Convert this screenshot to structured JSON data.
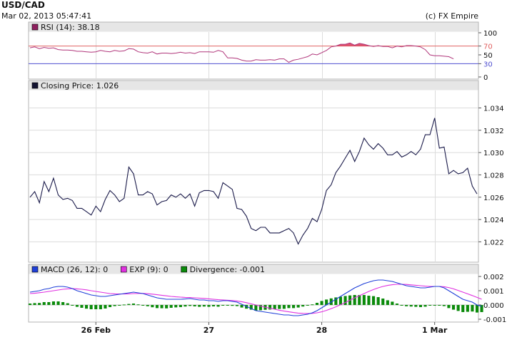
{
  "header": {
    "symbol": "USD/CAD",
    "timestamp": "Mar 02, 2013 05:47:41",
    "copyright": "(c) FX Empire"
  },
  "colors": {
    "panel_bg": "#ffffff",
    "panel_border": "#b4b4b4",
    "label_bar": "#e6e6e6",
    "grid": "#dcdcdc",
    "rsi_line": "#b0357a",
    "rsi_upper": "#e06060",
    "rsi_lower": "#5050d0",
    "price_line": "#1a1a4a",
    "macd_line": "#1f3fd8",
    "exp_line": "#e030e0",
    "divergence_bar": "#0a8a0a"
  },
  "x_axis": {
    "ticks": [
      {
        "label": "26 Feb",
        "i": 14
      },
      {
        "label": "27",
        "i": 38
      },
      {
        "label": "28",
        "i": 62
      },
      {
        "label": "1 Mar",
        "i": 86
      }
    ]
  },
  "chart_data": [
    {
      "type": "line",
      "name": "rsi",
      "label": "RSI (14): 38.18",
      "legend_color": "#8e1f5e",
      "ylim": [
        0,
        100
      ],
      "yticks": [
        "100",
        "70",
        "50",
        "30",
        "0"
      ],
      "ytick_values": [
        100,
        70,
        50,
        30,
        0
      ],
      "levels": [
        70,
        30
      ],
      "values": [
        66,
        68,
        64,
        67,
        65,
        66,
        62,
        61,
        61,
        60,
        58,
        58,
        57,
        56,
        57,
        60,
        58,
        57,
        60,
        58,
        59,
        64,
        63,
        57,
        55,
        54,
        57,
        52,
        54,
        54,
        53,
        54,
        56,
        54,
        55,
        53,
        57,
        57,
        57,
        56,
        60,
        57,
        43,
        43,
        42,
        38,
        36,
        36,
        39,
        38,
        38,
        39,
        38,
        41,
        41,
        33,
        38,
        40,
        43,
        46,
        52,
        50,
        55,
        60,
        68,
        70,
        74,
        74,
        77,
        72,
        76,
        74,
        71,
        69,
        71,
        69,
        69,
        66,
        70,
        68,
        71,
        71,
        70,
        68,
        62,
        50,
        48,
        48,
        47,
        46,
        41
      ]
    },
    {
      "type": "line",
      "name": "price",
      "label": "Closing Price: 1.026",
      "legend_color": "#141432",
      "ylim": [
        1.0203,
        1.0355
      ],
      "yticks": [
        "1.034",
        "1.032",
        "1.030",
        "1.028",
        "1.026",
        "1.024",
        "1.022"
      ],
      "ytick_values": [
        1.034,
        1.032,
        1.03,
        1.028,
        1.026,
        1.024,
        1.022
      ],
      "values": [
        1.026,
        1.0265,
        1.0255,
        1.0274,
        1.0265,
        1.0277,
        1.0262,
        1.0258,
        1.0259,
        1.0257,
        1.025,
        1.025,
        1.0247,
        1.0244,
        1.0252,
        1.0247,
        1.0258,
        1.0266,
        1.0262,
        1.0256,
        1.0259,
        1.0287,
        1.0281,
        1.0262,
        1.0262,
        1.0265,
        1.0263,
        1.0253,
        1.0256,
        1.0257,
        1.0262,
        1.026,
        1.0263,
        1.0259,
        1.0263,
        1.0252,
        1.0264,
        1.0266,
        1.0266,
        1.0265,
        1.0259,
        1.0273,
        1.027,
        1.0267,
        1.025,
        1.0249,
        1.0243,
        1.0232,
        1.023,
        1.0233,
        1.0233,
        1.0228,
        1.0228,
        1.0228,
        1.023,
        1.0232,
        1.0228,
        1.0218,
        1.0226,
        1.0232,
        1.0241,
        1.0238,
        1.0249,
        1.0266,
        1.0271,
        1.0282,
        1.0288,
        1.0295,
        1.0302,
        1.0292,
        1.0301,
        1.0313,
        1.0307,
        1.0303,
        1.0308,
        1.0304,
        1.0298,
        1.0298,
        1.0301,
        1.0296,
        1.0298,
        1.0301,
        1.0298,
        1.0303,
        1.0316,
        1.0316,
        1.0331,
        1.0304,
        1.0305,
        1.0281,
        1.0284,
        1.0281,
        1.0282,
        1.0286,
        1.027,
        1.0263
      ]
    },
    {
      "type": "line",
      "name": "macd",
      "label": "MACD (26, 12): 0",
      "ylim": [
        -0.0011,
        0.0021
      ],
      "yticks": [
        "0.002",
        "0.001",
        "0.000",
        "-0.001"
      ],
      "ytick_values": [
        0.002,
        0.001,
        0.0,
        -0.001
      ],
      "series": [
        {
          "name": "MACD (26, 12): 0",
          "legend_color": "#1f3fd8",
          "color": "#1f3fd8",
          "values": [
            0.0009,
            0.00095,
            0.001,
            0.0011,
            0.00115,
            0.00125,
            0.0013,
            0.0013,
            0.00125,
            0.00115,
            0.001,
            0.0009,
            0.0008,
            0.0007,
            0.00065,
            0.0006,
            0.0006,
            0.00065,
            0.0007,
            0.00075,
            0.0008,
            0.00085,
            0.0009,
            0.00085,
            0.0008,
            0.0007,
            0.0006,
            0.0005,
            0.00045,
            0.0004,
            0.0004,
            0.0004,
            0.0004,
            0.00042,
            0.00045,
            0.0004,
            0.00035,
            0.00035,
            0.0003,
            0.0003,
            0.00025,
            0.0003,
            0.0003,
            0.00025,
            0.0002,
            5e-05,
            -0.0001,
            -0.00025,
            -0.0004,
            -0.00045,
            -0.0005,
            -0.00055,
            -0.0006,
            -0.00065,
            -0.0007,
            -0.0007,
            -0.00075,
            -0.00075,
            -0.0007,
            -0.00065,
            -0.00055,
            -0.0004,
            -0.0002,
            0.0,
            0.0002,
            0.0004,
            0.0006,
            0.0008,
            0.001,
            0.0012,
            0.00135,
            0.0015,
            0.0016,
            0.0017,
            0.00175,
            0.00175,
            0.0017,
            0.00165,
            0.00155,
            0.00145,
            0.00135,
            0.0013,
            0.00125,
            0.0012,
            0.0012,
            0.00125,
            0.0013,
            0.0013,
            0.0012,
            0.001,
            0.0008,
            0.0006,
            0.0004,
            0.0003,
            0.0002,
            0.0,
            -0.0001
          ]
        },
        {
          "name": "EXP (9): 0",
          "legend_color": "#e030e0",
          "color": "#e030e0",
          "values": [
            0.0008,
            0.00082,
            0.00086,
            0.0009,
            0.00095,
            0.001,
            0.00105,
            0.0011,
            0.00113,
            0.00115,
            0.00113,
            0.0011,
            0.00106,
            0.001,
            0.00095,
            0.0009,
            0.00085,
            0.0008,
            0.00078,
            0.00077,
            0.00077,
            0.00078,
            0.0008,
            0.00081,
            0.00081,
            0.00079,
            0.00076,
            0.00072,
            0.00068,
            0.00064,
            0.0006,
            0.00057,
            0.00055,
            0.00053,
            0.00052,
            0.0005,
            0.00048,
            0.00046,
            0.00043,
            0.0004,
            0.00037,
            0.00035,
            0.00033,
            0.00031,
            0.00028,
            0.00023,
            0.00016,
            8e-05,
            0.0,
            -8e-05,
            -0.00016,
            -0.00023,
            -0.0003,
            -0.00037,
            -0.00043,
            -0.00048,
            -0.00053,
            -0.00057,
            -0.00059,
            -0.0006,
            -0.00059,
            -0.00055,
            -0.00048,
            -0.00038,
            -0.00026,
            -0.00013,
            2e-05,
            0.00017,
            0.00033,
            0.0005,
            0.00065,
            0.0008,
            0.00095,
            0.00108,
            0.0012,
            0.0013,
            0.00137,
            0.00142,
            0.00145,
            0.00145,
            0.00144,
            0.00141,
            0.00138,
            0.00135,
            0.00132,
            0.0013,
            0.0013,
            0.0013,
            0.00128,
            0.00122,
            0.00113,
            0.00102,
            0.0009,
            0.00078,
            0.00066,
            0.00053,
            0.0004
          ]
        },
        {
          "name": "Divergence: -0.001",
          "legend_color": "#0a8a0a",
          "color": "#0a8a0a",
          "kind": "bar",
          "values": [
            0.0001,
            0.00013,
            0.00014,
            0.0002,
            0.0002,
            0.00025,
            0.00025,
            0.0002,
            0.00012,
            0.0,
            -0.00013,
            -0.0002,
            -0.00026,
            -0.0003,
            -0.0003,
            -0.0003,
            -0.00025,
            -0.00015,
            -8e-05,
            -2e-05,
            3e-05,
            7e-05,
            0.0001,
            4e-05,
            -1e-05,
            -9e-05,
            -0.00016,
            -0.00022,
            -0.00023,
            -0.00024,
            -0.0002,
            -0.00017,
            -0.00015,
            -0.00011,
            -7e-05,
            -0.0001,
            -0.00013,
            -0.00011,
            -0.00013,
            -0.0001,
            -0.00012,
            -5e-05,
            -3e-05,
            -6e-05,
            -8e-05,
            -0.00018,
            -0.00026,
            -0.00033,
            -0.0004,
            -0.00037,
            -0.00034,
            -0.00032,
            -0.0003,
            -0.00028,
            -0.00027,
            -0.00022,
            -0.00022,
            -0.00018,
            -0.00011,
            -5e-05,
            4e-05,
            0.00015,
            0.00028,
            0.00038,
            0.00046,
            0.00053,
            0.00058,
            0.00063,
            0.00067,
            0.0007,
            0.0007,
            0.0007,
            0.00065,
            0.00062,
            0.00055,
            0.00045,
            0.00033,
            0.00023,
            0.0001,
            0.0,
            -9e-05,
            -0.00011,
            -0.00013,
            -0.00015,
            -0.00012,
            -5e-05,
            0.0,
            0.0,
            -8e-05,
            -0.00022,
            -0.00033,
            -0.00042,
            -0.0005,
            -0.00048,
            -0.00046,
            -0.00053,
            -0.0005
          ]
        }
      ]
    }
  ]
}
